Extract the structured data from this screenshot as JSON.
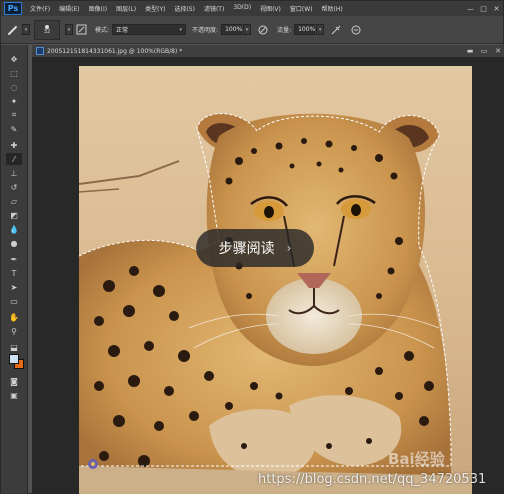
{
  "app": {
    "logo": "Ps"
  },
  "menu": [
    "文件(F)",
    "编辑(E)",
    "图像(I)",
    "图层(L)",
    "类型(Y)",
    "选择(S)",
    "滤镜(T)",
    "3D(D)",
    "视图(V)",
    "窗口(W)",
    "帮助(H)"
  ],
  "window_controls": [
    "—",
    "□",
    "✕"
  ],
  "options": {
    "brush_size": "32",
    "mode_label": "模式:",
    "mode_value": "正常",
    "opacity_label": "不透明度:",
    "opacity_value": "100%",
    "flow_label": "流量:",
    "flow_value": "100%"
  },
  "document": {
    "title": "200512151814331061.jpg @ 100%(RGB/8) *",
    "controls": [
      "▬",
      "▭",
      "✕"
    ]
  },
  "overlay": {
    "label": "步骤阅读",
    "chevron": "›"
  },
  "watermarks": {
    "baidu": "Bai经验",
    "csdn": "https://blog.csdn.net/qq_34720531"
  },
  "colors": {
    "foreground": "#cfe0f0",
    "background": "#e66a12"
  }
}
